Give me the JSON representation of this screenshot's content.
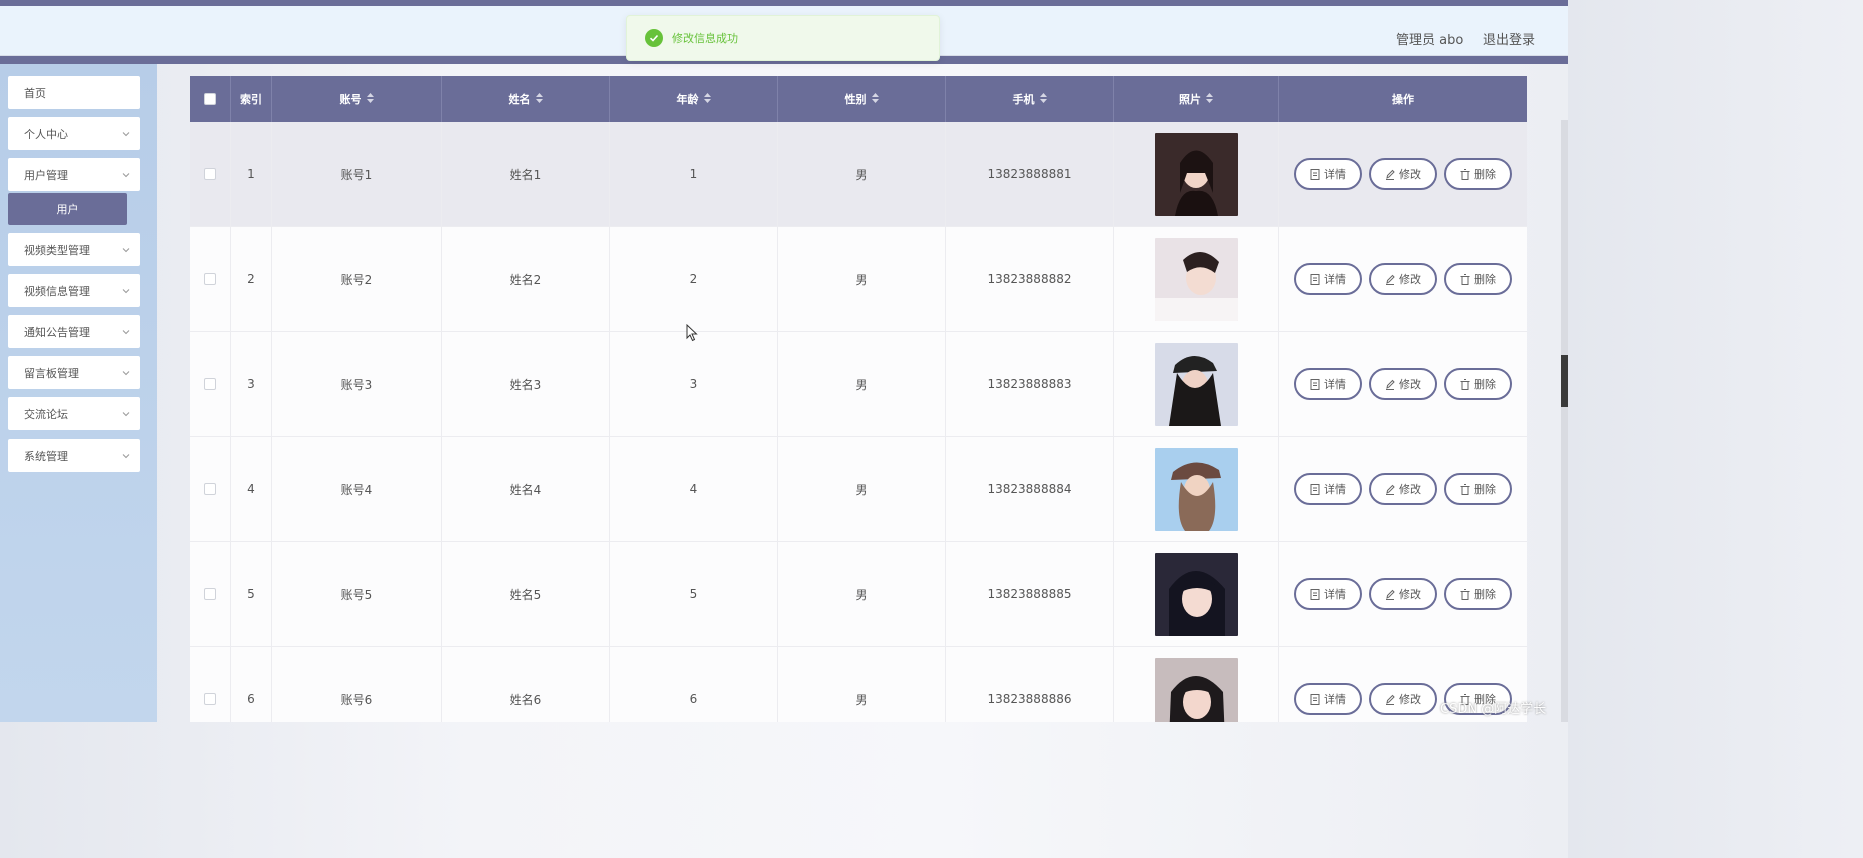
{
  "header": {
    "admin_label": "管理员 abo",
    "logout_label": "退出登录"
  },
  "toast": {
    "message": "修改信息成功",
    "icon": "check-circle-icon"
  },
  "sidebar": {
    "items": [
      {
        "label": "首页",
        "has_chevron": false
      },
      {
        "label": "个人中心",
        "has_chevron": true
      },
      {
        "label": "用户管理",
        "has_chevron": true
      },
      {
        "label": "视频类型管理",
        "has_chevron": true
      },
      {
        "label": "视频信息管理",
        "has_chevron": true
      },
      {
        "label": "通知公告管理",
        "has_chevron": true
      },
      {
        "label": "留言板管理",
        "has_chevron": true
      },
      {
        "label": "交流论坛",
        "has_chevron": true
      },
      {
        "label": "系统管理",
        "has_chevron": true
      }
    ],
    "active_sub": "用户"
  },
  "table": {
    "columns": [
      "索引",
      "账号",
      "姓名",
      "年龄",
      "性别",
      "手机",
      "照片",
      "操作"
    ],
    "rows": [
      {
        "index": "1",
        "account": "账号1",
        "name": "姓名1",
        "age": "1",
        "gender": "男",
        "phone": "13823888881"
      },
      {
        "index": "2",
        "account": "账号2",
        "name": "姓名2",
        "age": "2",
        "gender": "男",
        "phone": "13823888882"
      },
      {
        "index": "3",
        "account": "账号3",
        "name": "姓名3",
        "age": "3",
        "gender": "男",
        "phone": "13823888883"
      },
      {
        "index": "4",
        "account": "账号4",
        "name": "姓名4",
        "age": "4",
        "gender": "男",
        "phone": "13823888884"
      },
      {
        "index": "5",
        "account": "账号5",
        "name": "姓名5",
        "age": "5",
        "gender": "男",
        "phone": "13823888885"
      },
      {
        "index": "6",
        "account": "账号6",
        "name": "姓名6",
        "age": "6",
        "gender": "男",
        "phone": "13823888886"
      }
    ],
    "actions": {
      "detail": "详情",
      "edit": "修改",
      "delete": "删除"
    }
  },
  "watermark": "CSDN @阿达学长",
  "colors": {
    "accent": "#6a6d98",
    "success": "#67c23a",
    "sidebar": "#b7cde8"
  }
}
